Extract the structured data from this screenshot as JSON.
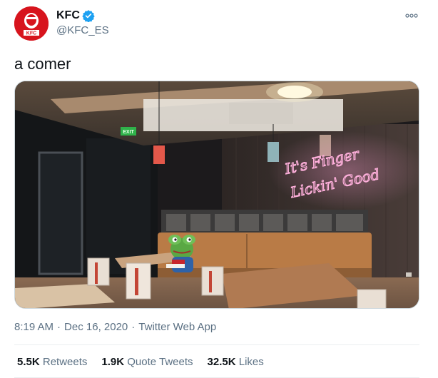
{
  "author": {
    "display_name": "KFC",
    "handle": "@KFC_ES",
    "avatar_text": "KFC",
    "verified": true
  },
  "tweet": {
    "text": "a comer",
    "time": "8:19 AM",
    "date": "Dec 16, 2020",
    "separator": "·",
    "source": "Twitter Web App"
  },
  "media": {
    "neon_line1": "It's Finger",
    "neon_line2": "Lickin' Good",
    "exit_sign": "EXIT"
  },
  "stats": [
    {
      "count": "5.5K",
      "label": "Retweets"
    },
    {
      "count": "1.9K",
      "label": "Quote Tweets"
    },
    {
      "count": "32.5K",
      "label": "Likes"
    }
  ],
  "colors": {
    "brand_red": "#d7141d",
    "verified_blue": "#1da1f2",
    "secondary_text": "#5b7083"
  }
}
